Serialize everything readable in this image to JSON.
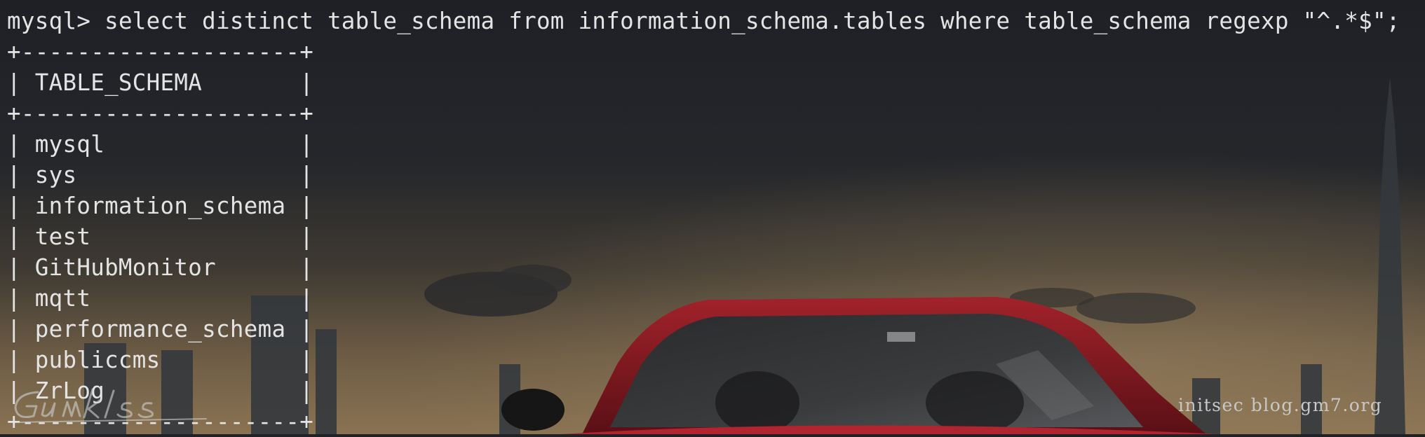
{
  "terminal": {
    "prompt": "mysql> ",
    "command": "select distinct table_schema from information_schema.tables where table_schema regexp \"^.*$\";",
    "border": "+--------------------+",
    "header": "| TABLE_SCHEMA       |",
    "rows": [
      "| mysql              |",
      "| sys                |",
      "| information_schema |",
      "| test               |",
      "| GitHubMonitor      |",
      "| mqtt               |",
      "| performance_schema |",
      "| publiccms          |",
      "| ZrLog              |"
    ]
  },
  "watermark": {
    "text": "initsec blog.gm7.org",
    "signature": "Gumklss"
  },
  "colors": {
    "text": "#e4e4e4",
    "sky_top": "#1e2026",
    "horizon": "#8a7352",
    "car_red": "#8e1c24"
  }
}
